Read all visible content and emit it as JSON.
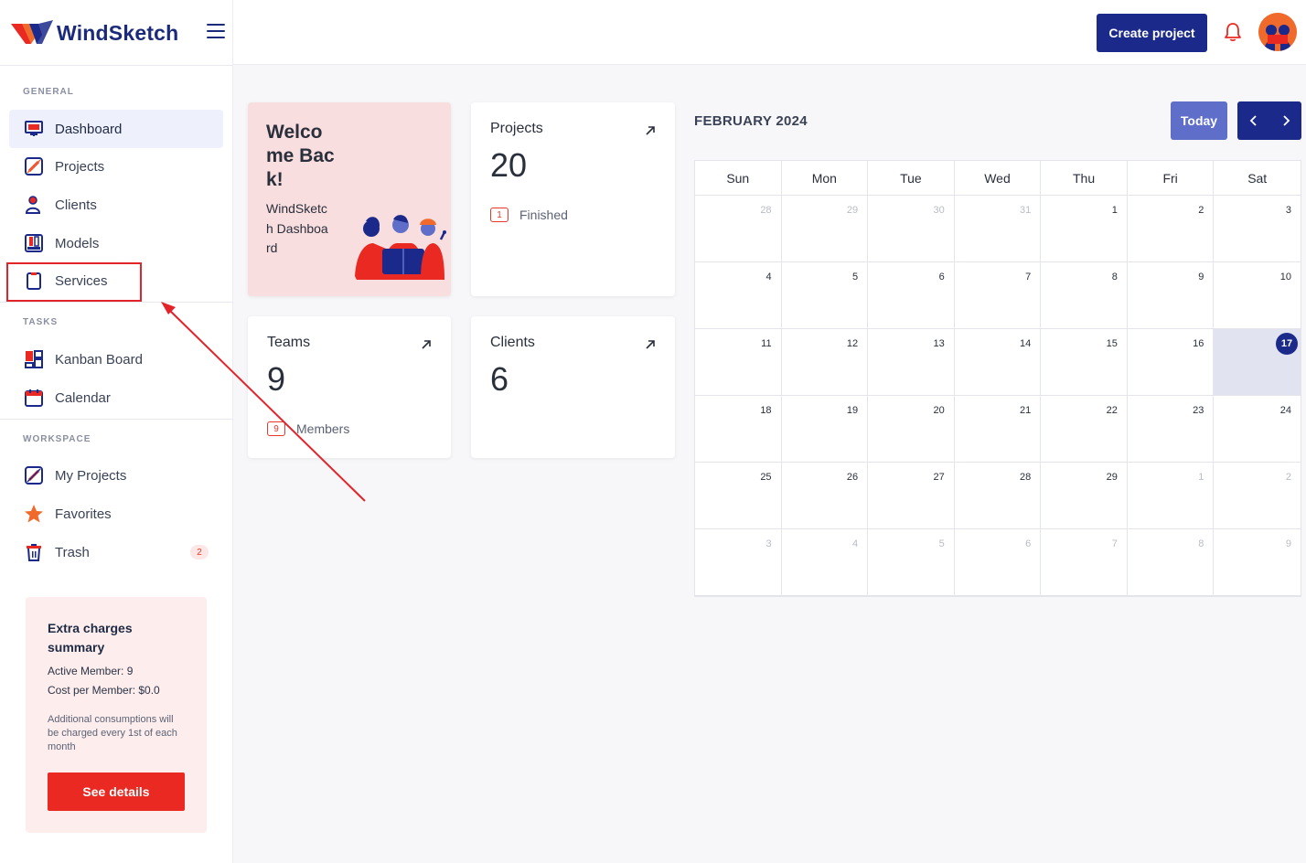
{
  "brand": {
    "name": "WindSketch"
  },
  "sidebar": {
    "sections": [
      {
        "label": "GENERAL"
      },
      {
        "label": "TASKS"
      },
      {
        "label": "WORKSPACE"
      }
    ],
    "items": [
      {
        "label": "Dashboard",
        "icon": "dashboard-icon",
        "active": true
      },
      {
        "label": "Projects",
        "icon": "projects-icon"
      },
      {
        "label": "Clients",
        "icon": "clients-icon"
      },
      {
        "label": "Models",
        "icon": "models-icon"
      },
      {
        "label": "Services",
        "icon": "services-icon"
      },
      {
        "label": "Kanban Board",
        "icon": "kanban-icon"
      },
      {
        "label": "Calendar",
        "icon": "calendar-icon"
      },
      {
        "label": "My Projects",
        "icon": "my-projects-icon"
      },
      {
        "label": "Favorites",
        "icon": "star-icon"
      },
      {
        "label": "Trash",
        "icon": "trash-icon",
        "badge": "2"
      }
    ]
  },
  "charges": {
    "title": "Extra charges summary",
    "active_member": "Active Member: 9",
    "cost_per_member": "Cost per Member: $0.0",
    "note": "Additional consumptions will be charged every 1st of each month",
    "button": "See details"
  },
  "topbar": {
    "create_label": "Create project"
  },
  "welcome": {
    "title": "Welcome Back!",
    "subtitle": "WindSketch Dashboard"
  },
  "stats": {
    "projects": {
      "title": "Projects",
      "value": "20",
      "badge": "1",
      "foot": "Finished"
    },
    "teams": {
      "title": "Teams",
      "value": "9",
      "badge": "9",
      "foot": "Members"
    },
    "clients": {
      "title": "Clients",
      "value": "6"
    }
  },
  "calendar": {
    "title": "FEBRUARY 2024",
    "today_label": "Today",
    "weekdays": [
      "Sun",
      "Mon",
      "Tue",
      "Wed",
      "Thu",
      "Fri",
      "Sat"
    ],
    "days": [
      {
        "n": "28",
        "m": true
      },
      {
        "n": "29",
        "m": true
      },
      {
        "n": "30",
        "m": true
      },
      {
        "n": "31",
        "m": true
      },
      {
        "n": "1"
      },
      {
        "n": "2"
      },
      {
        "n": "3"
      },
      {
        "n": "4"
      },
      {
        "n": "5"
      },
      {
        "n": "6"
      },
      {
        "n": "7"
      },
      {
        "n": "8"
      },
      {
        "n": "9"
      },
      {
        "n": "10"
      },
      {
        "n": "11"
      },
      {
        "n": "12"
      },
      {
        "n": "13"
      },
      {
        "n": "14"
      },
      {
        "n": "15"
      },
      {
        "n": "16"
      },
      {
        "n": "17",
        "t": true
      },
      {
        "n": "18"
      },
      {
        "n": "19"
      },
      {
        "n": "20"
      },
      {
        "n": "21"
      },
      {
        "n": "22"
      },
      {
        "n": "23"
      },
      {
        "n": "24"
      },
      {
        "n": "25"
      },
      {
        "n": "26"
      },
      {
        "n": "27"
      },
      {
        "n": "28"
      },
      {
        "n": "29"
      },
      {
        "n": "1",
        "m": true
      },
      {
        "n": "2",
        "m": true
      },
      {
        "n": "3",
        "m": true
      },
      {
        "n": "4",
        "m": true
      },
      {
        "n": "5",
        "m": true
      },
      {
        "n": "6",
        "m": true
      },
      {
        "n": "7",
        "m": true
      },
      {
        "n": "8",
        "m": true
      },
      {
        "n": "9",
        "m": true
      }
    ]
  },
  "colors": {
    "brand_navy": "#1b2a8a",
    "accent_red": "#ea2a22",
    "today_btn": "#5f6fc9"
  }
}
